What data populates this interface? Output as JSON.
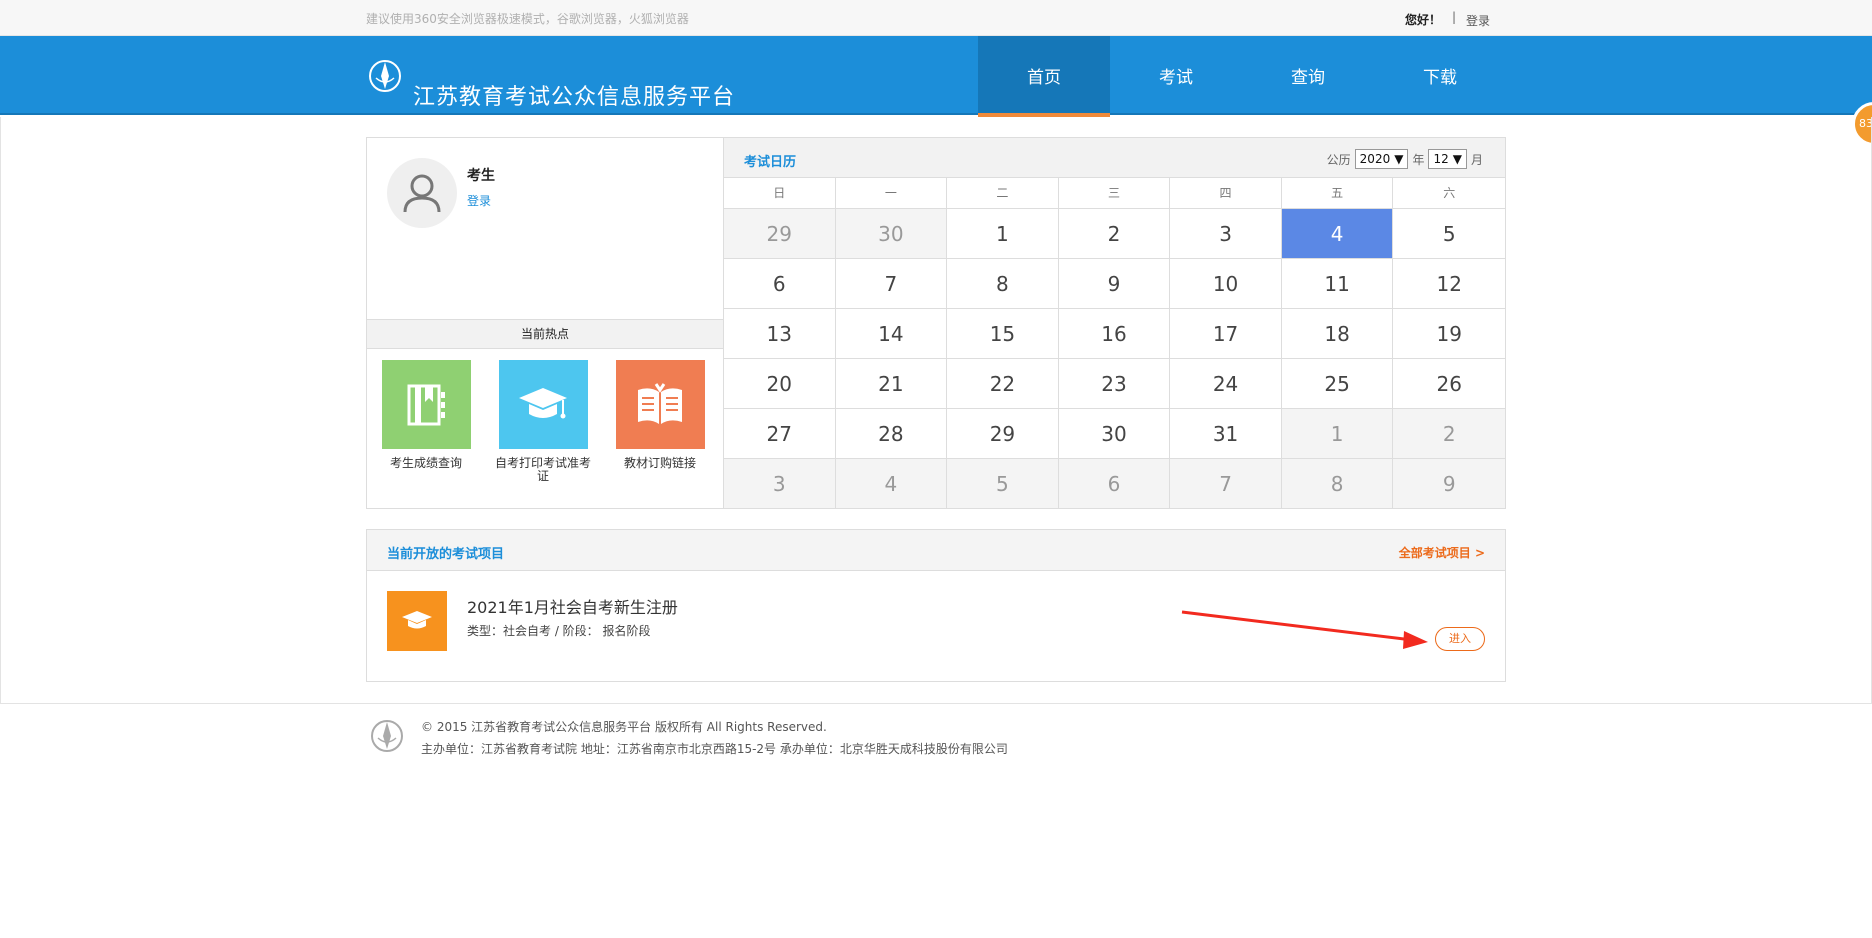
{
  "topbar": {
    "tip": "建议使用360安全浏览器极速模式，谷歌浏览器，火狐浏览器",
    "greeting": "您好！",
    "separator": "|",
    "login": "登录"
  },
  "header": {
    "title": "江苏教育考试公众信息服务平台",
    "nav": [
      "首页",
      "考试",
      "查询",
      "下载"
    ],
    "float_badge": "83"
  },
  "profile": {
    "name": "考生",
    "login": "登录"
  },
  "hot": {
    "title": "当前热点",
    "items": [
      {
        "label": "考生成绩查询",
        "color": "#8fd072",
        "icon": "notebook-icon"
      },
      {
        "label": "自考打印考试准考证",
        "color": "#4dc6ef",
        "icon": "graduation-cap-icon"
      },
      {
        "label": "教材订购链接",
        "color": "#f07d52",
        "icon": "open-book-icon"
      }
    ]
  },
  "calendar": {
    "title": "考试日历",
    "calendar_label": "公历",
    "year": "2020",
    "year_unit": "年",
    "month": "12",
    "month_unit": "月",
    "weekdays": [
      "日",
      "一",
      "二",
      "三",
      "四",
      "五",
      "六"
    ],
    "days": [
      {
        "d": "29",
        "other": true
      },
      {
        "d": "30",
        "other": true
      },
      {
        "d": "1"
      },
      {
        "d": "2"
      },
      {
        "d": "3"
      },
      {
        "d": "4",
        "today": true
      },
      {
        "d": "5"
      },
      {
        "d": "6"
      },
      {
        "d": "7"
      },
      {
        "d": "8"
      },
      {
        "d": "9"
      },
      {
        "d": "10"
      },
      {
        "d": "11"
      },
      {
        "d": "12"
      },
      {
        "d": "13"
      },
      {
        "d": "14"
      },
      {
        "d": "15"
      },
      {
        "d": "16"
      },
      {
        "d": "17"
      },
      {
        "d": "18"
      },
      {
        "d": "19"
      },
      {
        "d": "20"
      },
      {
        "d": "21"
      },
      {
        "d": "22"
      },
      {
        "d": "23"
      },
      {
        "d": "24"
      },
      {
        "d": "25"
      },
      {
        "d": "26"
      },
      {
        "d": "27"
      },
      {
        "d": "28"
      },
      {
        "d": "29"
      },
      {
        "d": "30"
      },
      {
        "d": "31"
      },
      {
        "d": "1",
        "other": true
      },
      {
        "d": "2",
        "other": true
      },
      {
        "d": "3",
        "other": true
      },
      {
        "d": "4",
        "other": true
      },
      {
        "d": "5",
        "other": true
      },
      {
        "d": "6",
        "other": true
      },
      {
        "d": "7",
        "other": true
      },
      {
        "d": "8",
        "other": true
      },
      {
        "d": "9",
        "other": true
      }
    ],
    "today_color": "#5b88e5"
  },
  "exams": {
    "title": "当前开放的考试项目",
    "all_link": "全部考试项目 >",
    "item": {
      "name": "2021年1月社会自考新生注册",
      "meta": "类型：社会自考 / 阶段： 报名阶段",
      "enter": "进入"
    }
  },
  "footer": {
    "copyright": "© 2015 江苏省教育考试公众信息服务平台 版权所有 All Rights Reserved.",
    "org": "主办单位：江苏省教育考试院 地址：江苏省南京市北京西路15-2号 承办单位：北京华胜天成科技股份有限公司"
  },
  "colors": {
    "brand_blue": "#1c8ed9",
    "accent_orange": "#ec6a1a",
    "annotation_arrow": "#f22a1f"
  }
}
